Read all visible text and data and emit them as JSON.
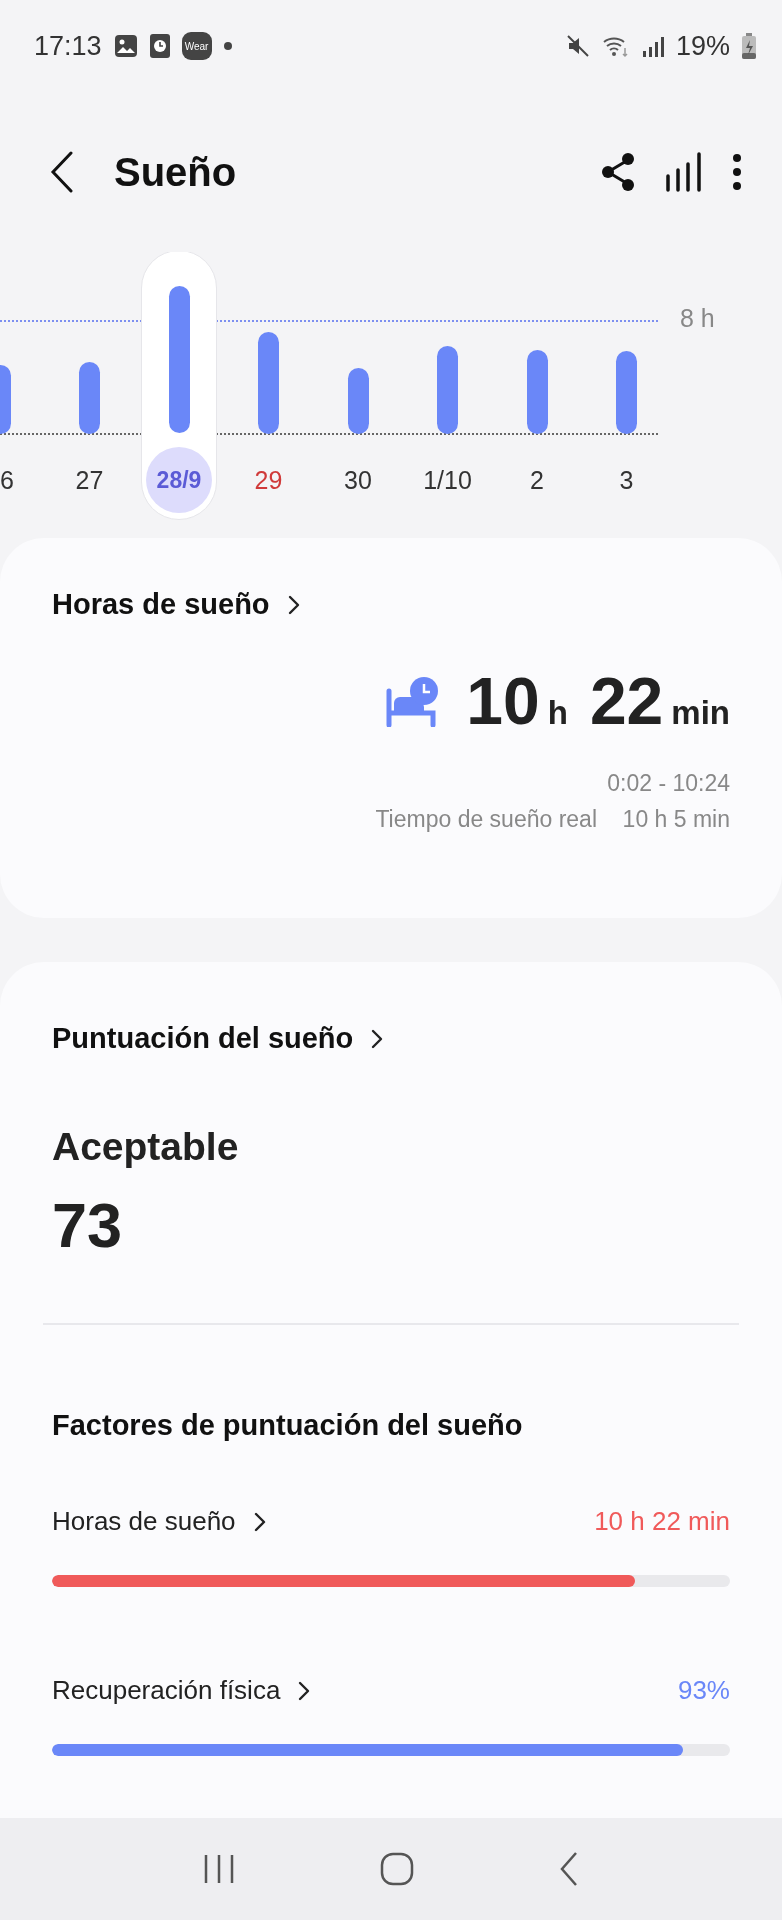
{
  "status_bar": {
    "time": "17:13",
    "wear_badge": "Wear",
    "battery": "19%"
  },
  "header": {
    "title": "Sueño"
  },
  "chart": {
    "reference_label": "8 h",
    "days": [
      {
        "label": "6",
        "selected": false,
        "kind": "weekday"
      },
      {
        "label": "27",
        "selected": false,
        "kind": "weekday"
      },
      {
        "label": "28/9",
        "selected": true,
        "kind": "weekday"
      },
      {
        "label": "29",
        "selected": false,
        "kind": "sunday"
      },
      {
        "label": "30",
        "selected": false,
        "kind": "weekday"
      },
      {
        "label": "1/10",
        "selected": false,
        "kind": "weekday"
      },
      {
        "label": "2",
        "selected": false,
        "kind": "weekday"
      },
      {
        "label": "3",
        "selected": false,
        "kind": "weekday"
      }
    ]
  },
  "sleep_hours": {
    "title": "Horas de sueño",
    "hours": "10",
    "hours_unit": "h",
    "minutes": "22",
    "minutes_unit": "min",
    "range": "0:02 - 10:24",
    "actual_label": "Tiempo de sueño real",
    "actual_value": "10 h 5 min"
  },
  "sleep_score": {
    "title": "Puntuación del sueño",
    "rating": "Aceptable",
    "score": "73",
    "factors_title": "Factores de puntuación del sueño",
    "factors": [
      {
        "label": "Horas de sueño",
        "value": "10 h 22 min",
        "level": 0.86,
        "color": "#f05a5a"
      },
      {
        "label": "Recuperación física",
        "value": "93%",
        "level": 0.93,
        "color": "#6a87f8"
      }
    ]
  }
}
